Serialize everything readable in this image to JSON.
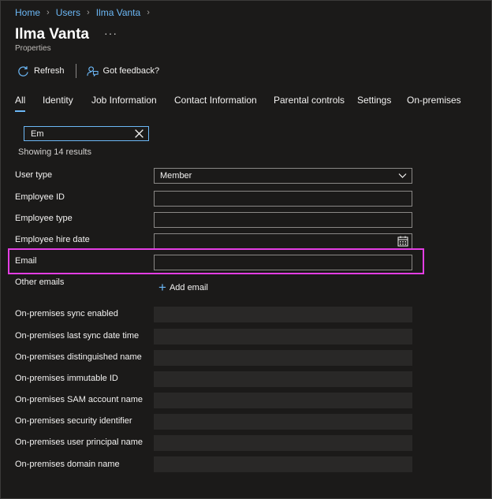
{
  "breadcrumb": [
    "Home",
    "Users",
    "Ilma Vanta"
  ],
  "page": {
    "title": "Ilma Vanta",
    "more": "···",
    "subtitle": "Properties"
  },
  "toolbar": {
    "refresh": "Refresh",
    "feedback": "Got feedback?"
  },
  "tabs": [
    {
      "label": "All",
      "active": true
    },
    {
      "label": "Identity"
    },
    {
      "label": "Job Information"
    },
    {
      "label": "Contact Information"
    },
    {
      "label": "Parental controls"
    },
    {
      "label": "Settings"
    },
    {
      "label": "On-premises"
    }
  ],
  "search": {
    "value": "Em"
  },
  "results_text": "Showing 14 results",
  "fields": {
    "user_type": {
      "label": "User type",
      "value": "Member"
    },
    "employee_id": {
      "label": "Employee ID",
      "value": ""
    },
    "employee_type": {
      "label": "Employee type",
      "value": ""
    },
    "employee_hire_date": {
      "label": "Employee hire date",
      "value": ""
    },
    "email": {
      "label": "Email",
      "value": ""
    },
    "other_emails": {
      "label": "Other emails",
      "add_label": "Add email"
    },
    "onprem_sync_enabled": {
      "label": "On-premises sync enabled"
    },
    "onprem_last_sync": {
      "label": "On-premises last sync date time"
    },
    "onprem_dn": {
      "label": "On-premises distinguished name"
    },
    "onprem_immutable_id": {
      "label": "On-premises immutable ID"
    },
    "onprem_sam": {
      "label": "On-premises SAM account name"
    },
    "onprem_sid": {
      "label": "On-premises security identifier"
    },
    "onprem_upn": {
      "label": "On-premises user principal name"
    },
    "onprem_domain": {
      "label": "On-premises domain name"
    }
  },
  "colors": {
    "accent": "#6cb8f6",
    "highlight": "#e43ee4",
    "background": "#1b1a19"
  },
  "icons": [
    "refresh-icon",
    "feedback-icon",
    "clear-icon",
    "chevron-down-icon",
    "calendar-icon",
    "plus-icon",
    "chevron-right-icon",
    "more-icon"
  ]
}
